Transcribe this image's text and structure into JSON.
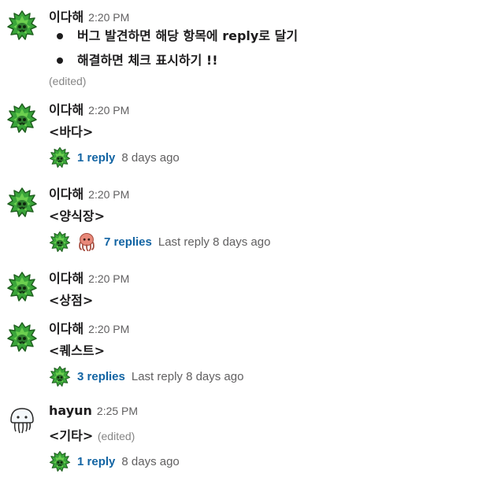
{
  "messages": [
    {
      "user": "이다해",
      "time": "2:20 PM",
      "bullets": [
        "버그 발견하면 해당 항목에 reply로 달기",
        "해결하면 체크 표시하기 !!"
      ],
      "edited": "(edited)"
    },
    {
      "user": "이다해",
      "time": "2:20 PM",
      "text": "<바다>",
      "thread": {
        "replies": "1 reply",
        "last": "8 days ago"
      }
    },
    {
      "user": "이다해",
      "time": "2:20 PM",
      "text": "<양식장>",
      "thread": {
        "replies": "7 replies",
        "last": "Last reply 8 days ago"
      }
    },
    {
      "user": "이다해",
      "time": "2:20 PM",
      "text": "<상점>"
    },
    {
      "user": "이다해",
      "time": "2:20 PM",
      "text": "<퀘스트>",
      "thread": {
        "replies": "3 replies",
        "last": "Last reply 8 days ago"
      }
    },
    {
      "user": "hayun",
      "time": "2:25 PM",
      "text": "<기타>",
      "edited": "(edited)",
      "thread": {
        "replies": "1 reply",
        "last": "8 days ago"
      }
    }
  ],
  "icons": {
    "seaweed_avatar": "seaweed-icon",
    "jellyfish_avatar": "jellyfish-icon",
    "octopus_avatar": "octopus-icon"
  },
  "colors": {
    "link": "#1264a3",
    "meta": "#616061",
    "seaweed": "#3aa53a",
    "octopus": "#e8897a"
  }
}
